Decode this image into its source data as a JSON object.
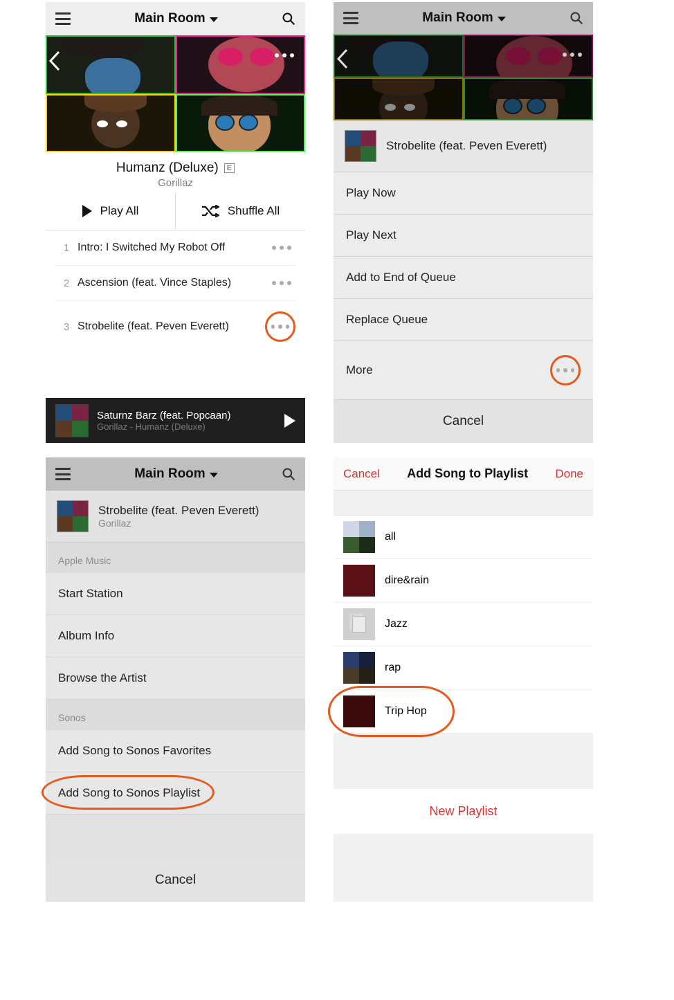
{
  "common": {
    "room": "Main Room"
  },
  "p1": {
    "album_title": "Humanz (Deluxe)",
    "explicit": "E",
    "artist": "Gorillaz",
    "play_all": "Play All",
    "shuffle_all": "Shuffle All",
    "tracks": [
      {
        "num": "1",
        "title": "Intro: I Switched My Robot Off"
      },
      {
        "num": "2",
        "title": "Ascension (feat. Vince Staples)"
      },
      {
        "num": "3",
        "title": "Strobelite (feat. Peven Everett)"
      }
    ],
    "np_line1": "Saturnz Barz (feat. Popcaan)",
    "np_line2": "Gorillaz - Humanz (Deluxe)"
  },
  "p2": {
    "song": "Strobelite (feat. Peven Everett)",
    "items": [
      "Play Now",
      "Play Next",
      "Add to End of Queue",
      "Replace Queue"
    ],
    "more": "More",
    "cancel": "Cancel"
  },
  "p3": {
    "song": "Strobelite (feat. Peven Everett)",
    "artist": "Gorillaz",
    "sec1": "Apple Music",
    "apple": [
      "Start Station",
      "Album Info",
      "Browse the Artist"
    ],
    "sec2": "Sonos",
    "sonos": [
      "Add Song to Sonos Favorites",
      "Add Song to Sonos Playlist"
    ],
    "cancel": "Cancel"
  },
  "p4": {
    "cancel": "Cancel",
    "title": "Add Song to Playlist",
    "done": "Done",
    "playlists": [
      "all",
      "dire&rain",
      "Jazz",
      "rap",
      "Trip Hop"
    ],
    "new": "New Playlist"
  }
}
